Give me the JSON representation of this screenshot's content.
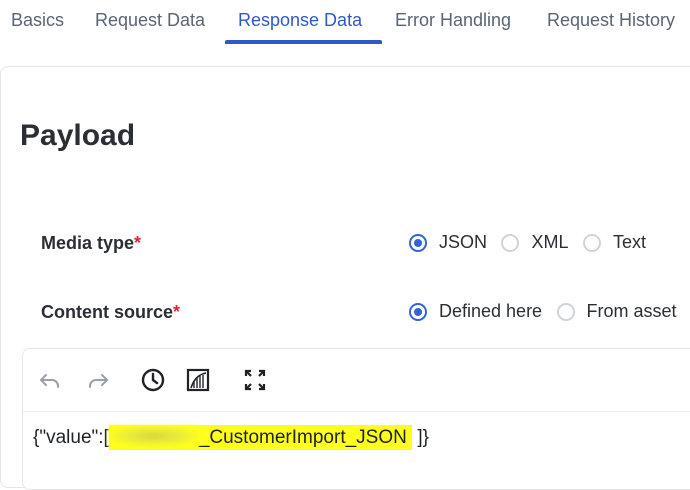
{
  "tabs": [
    {
      "label": "Basics",
      "active": false
    },
    {
      "label": "Request Data",
      "active": false
    },
    {
      "label": "Response Data",
      "active": true
    },
    {
      "label": "Error Handling",
      "active": false
    },
    {
      "label": "Request History",
      "active": false
    }
  ],
  "payload": {
    "title": "Payload",
    "media_type": {
      "label": "Media type",
      "required_mark": "*",
      "options": [
        {
          "label": "JSON",
          "checked": true
        },
        {
          "label": "XML",
          "checked": false
        },
        {
          "label": "Text",
          "checked": false
        }
      ]
    },
    "content_source": {
      "label": "Content source",
      "required_mark": "*",
      "options": [
        {
          "label": "Defined here",
          "checked": true
        },
        {
          "label": "From asset",
          "checked": false
        }
      ]
    }
  },
  "editor": {
    "toolbar": [
      {
        "icon": "undo-icon"
      },
      {
        "icon": "redo-icon"
      },
      {
        "icon": "history-icon"
      },
      {
        "icon": "chart-icon"
      },
      {
        "icon": "expand-icon"
      }
    ],
    "code_prefix": "{\"value\":[",
    "highlighted_text": "_CustomerImport_JSON",
    "code_suffix": "]}"
  },
  "colors": {
    "accent": "#2e59c8",
    "required": "#d7263d",
    "highlight": "#ffff1e"
  }
}
